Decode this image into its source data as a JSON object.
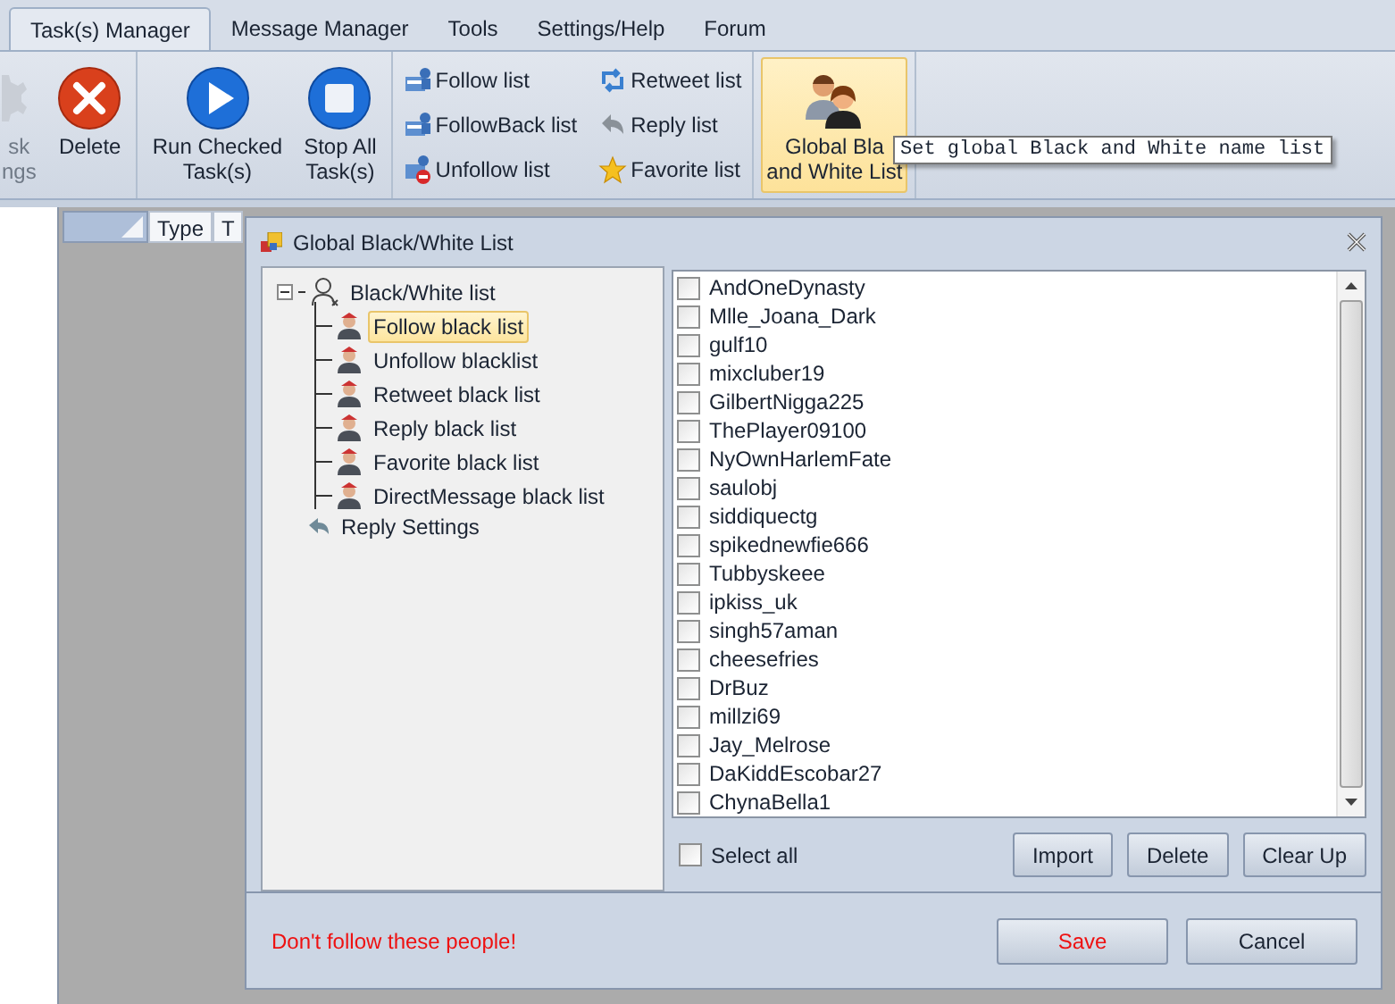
{
  "tabs": [
    {
      "label": "Task(s) Manager",
      "selected": true
    },
    {
      "label": "Message Manager",
      "selected": false
    },
    {
      "label": "Tools",
      "selected": false
    },
    {
      "label": "Settings/Help",
      "selected": false
    },
    {
      "label": "Forum",
      "selected": false
    }
  ],
  "ribbon": {
    "groups": [
      {
        "kind": "large",
        "items": [
          {
            "lines": [
              "sk",
              "ngs"
            ],
            "disabled": true,
            "highlighted": false
          },
          {
            "lines": [
              "Delete"
            ],
            "disabled": false,
            "highlighted": false
          }
        ]
      },
      {
        "kind": "large",
        "items": [
          {
            "lines": [
              "Run Checked",
              "Task(s)"
            ],
            "disabled": false,
            "highlighted": false
          },
          {
            "lines": [
              "Stop All",
              "Task(s)"
            ],
            "disabled": false,
            "highlighted": false
          }
        ]
      },
      {
        "kind": "small",
        "items": [
          {
            "label": "Follow list"
          },
          {
            "label": "FollowBack list"
          },
          {
            "label": "Unfollow list"
          },
          {
            "label": "Retweet list"
          },
          {
            "label": "Reply list"
          },
          {
            "label": "Favorite list"
          }
        ]
      },
      {
        "kind": "large",
        "items": [
          {
            "lines": [
              "Global Bla",
              "and White List"
            ],
            "disabled": false,
            "highlighted": true
          }
        ]
      }
    ]
  },
  "tooltip": {
    "text": "Set global Black and White name list"
  },
  "grid_header": {
    "columns": [
      "Type",
      "T"
    ]
  },
  "dialog": {
    "title": "Global Black/White List",
    "tree": [
      {
        "label": "Black/White list",
        "expanded": true,
        "selected": false,
        "children": [
          {
            "label": "Follow black list",
            "selected": true
          },
          {
            "label": "Unfollow blacklist",
            "selected": false
          },
          {
            "label": "Retweet black list",
            "selected": false
          },
          {
            "label": "Reply black list",
            "selected": false
          },
          {
            "label": "Favorite black list",
            "selected": false
          },
          {
            "label": "DirectMessage black list",
            "selected": false
          }
        ]
      },
      {
        "label": "Reply Settings",
        "selected": false
      }
    ],
    "names": [
      {
        "name": "AndOneDynasty",
        "checked": false
      },
      {
        "name": "Mlle_Joana_Dark",
        "checked": false
      },
      {
        "name": "gulf10",
        "checked": false
      },
      {
        "name": "mixcluber19",
        "checked": false
      },
      {
        "name": "GilbertNigga225",
        "checked": false
      },
      {
        "name": "ThePlayer09100",
        "checked": false
      },
      {
        "name": "NyOwnHarlemFate",
        "checked": false
      },
      {
        "name": "saulobj",
        "checked": false
      },
      {
        "name": "siddiquectg",
        "checked": false
      },
      {
        "name": "spikednewfie666",
        "checked": false
      },
      {
        "name": "Tubbyskeee",
        "checked": false
      },
      {
        "name": "ipkiss_uk",
        "checked": false
      },
      {
        "name": "singh57aman",
        "checked": false
      },
      {
        "name": "cheesefries",
        "checked": false
      },
      {
        "name": "DrBuz",
        "checked": false
      },
      {
        "name": "millzi69",
        "checked": false
      },
      {
        "name": "Jay_Melrose",
        "checked": false
      },
      {
        "name": "DaKiddEscobar27",
        "checked": false
      },
      {
        "name": "ChynaBella1",
        "checked": false
      }
    ],
    "select_all": {
      "label": "Select all",
      "checked": false
    },
    "list_buttons": [
      "Import",
      "Delete",
      "Clear Up"
    ],
    "message": "Don't follow these people!",
    "buttons": [
      {
        "label": "Save",
        "kind": "primary"
      },
      {
        "label": "Cancel",
        "kind": "normal"
      }
    ]
  }
}
